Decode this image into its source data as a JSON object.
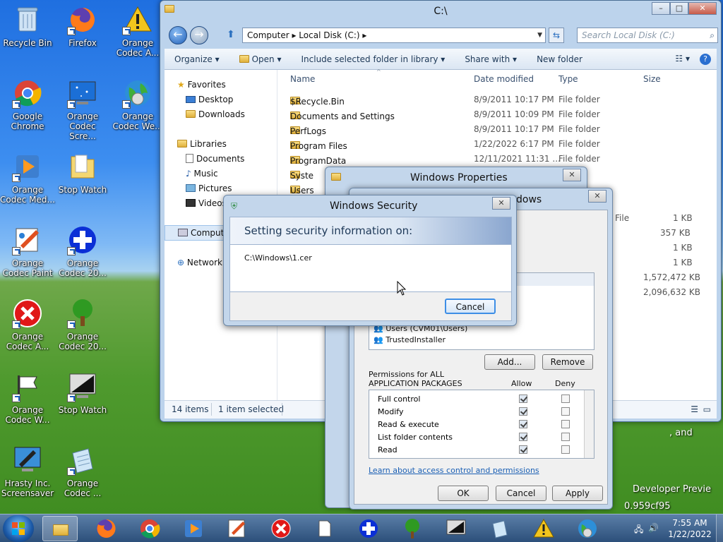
{
  "desktop": {
    "icons": [
      {
        "label": "Recycle Bin"
      },
      {
        "label": "Firefox"
      },
      {
        "label": "Orange Codec A..."
      },
      {
        "label": "Google Chrome"
      },
      {
        "label": "Orange Codec Scre..."
      },
      {
        "label": "Orange Codec We..."
      },
      {
        "label": "Orange Codec Med..."
      },
      {
        "label": "Stop Watch"
      },
      {
        "label": "Orange Codec Paint"
      },
      {
        "label": "Orange Codec 20..."
      },
      {
        "label": "Orange Codec A..."
      },
      {
        "label": "Orange Codec 20..."
      },
      {
        "label": "Orange Codec W..."
      },
      {
        "label": "Stop Watch"
      },
      {
        "label": "Hrasty Inc. Screensaver"
      },
      {
        "label": "Orange Codec ..."
      }
    ],
    "bg_text_1": "Developer Previe",
    "bg_text_2": "0.959cf95",
    "bg_text_3": ", and"
  },
  "explorer": {
    "title": "C:\\",
    "address": "Computer  ▸  Local Disk (C:)  ▸",
    "search_placeholder": "Search Local Disk (C:)",
    "toolbar": {
      "organize": "Organize ▾",
      "open": "Open ▾",
      "include": "Include selected folder in library ▾",
      "share": "Share with ▾",
      "newfolder": "New folder"
    },
    "nav": {
      "favorites": "Favorites",
      "desktop": "Desktop",
      "downloads": "Downloads",
      "libraries": "Libraries",
      "documents": "Documents",
      "music": "Music",
      "pictures": "Pictures",
      "videos": "Videos",
      "computer": "Comput",
      "network": "Network"
    },
    "columns": {
      "name": "Name",
      "date": "Date modified",
      "type": "Type",
      "size": "Size"
    },
    "rows": [
      {
        "name": "$Recycle.Bin",
        "date": "8/9/2011 10:17 PM",
        "type": "File folder"
      },
      {
        "name": "Documents and Settings",
        "date": "8/9/2011 10:09 PM",
        "type": "File folder"
      },
      {
        "name": "PerfLogs",
        "date": "8/9/2011 10:17 PM",
        "type": "File folder"
      },
      {
        "name": "Program Files",
        "date": "1/22/2022 6:17 PM",
        "type": "File folder"
      },
      {
        "name": "ProgramData",
        "date": "12/11/2021 11:31 ...",
        "type": "File folder"
      },
      {
        "name": "Syste",
        "date": "",
        "type": ""
      },
      {
        "name": "Users",
        "date": "",
        "type": ""
      }
    ],
    "right_sizes": [
      {
        "type": "File",
        "size": "1 KB"
      },
      {
        "type": "",
        "size": "357 KB"
      },
      {
        "type": "",
        "size": "1 KB"
      },
      {
        "type": "",
        "size": "1 KB"
      },
      {
        "type": "",
        "size": "1,572,472 KB"
      },
      {
        "type": "",
        "size": "2,096,632 KB"
      }
    ],
    "status": {
      "count": "14 items",
      "selected": "1 item selected"
    }
  },
  "props_back": {
    "title": "Windows Properties"
  },
  "props_front": {
    "title": "dows",
    "users_item": "Users (CVM01\\Users)",
    "trusted": "TrustedInstaller",
    "add": "Add...",
    "remove": "Remove",
    "perm_label_1": "Permissions for ALL",
    "perm_label_2": "APPLICATION PACKAGES",
    "allow": "Allow",
    "deny": "Deny",
    "perms": [
      "Full control",
      "Modify",
      "Read & execute",
      "List folder contents",
      "Read"
    ],
    "learn": "Learn about access control and permissions",
    "ok": "OK",
    "cancel": "Cancel",
    "apply": "Apply"
  },
  "security": {
    "title": "Windows Security",
    "heading": "Setting security information on:",
    "path": "C:\\Windows\\1.cer",
    "cancel": "Cancel"
  },
  "taskbar": {
    "time": "7:55 AM",
    "date": "1/22/2022"
  }
}
